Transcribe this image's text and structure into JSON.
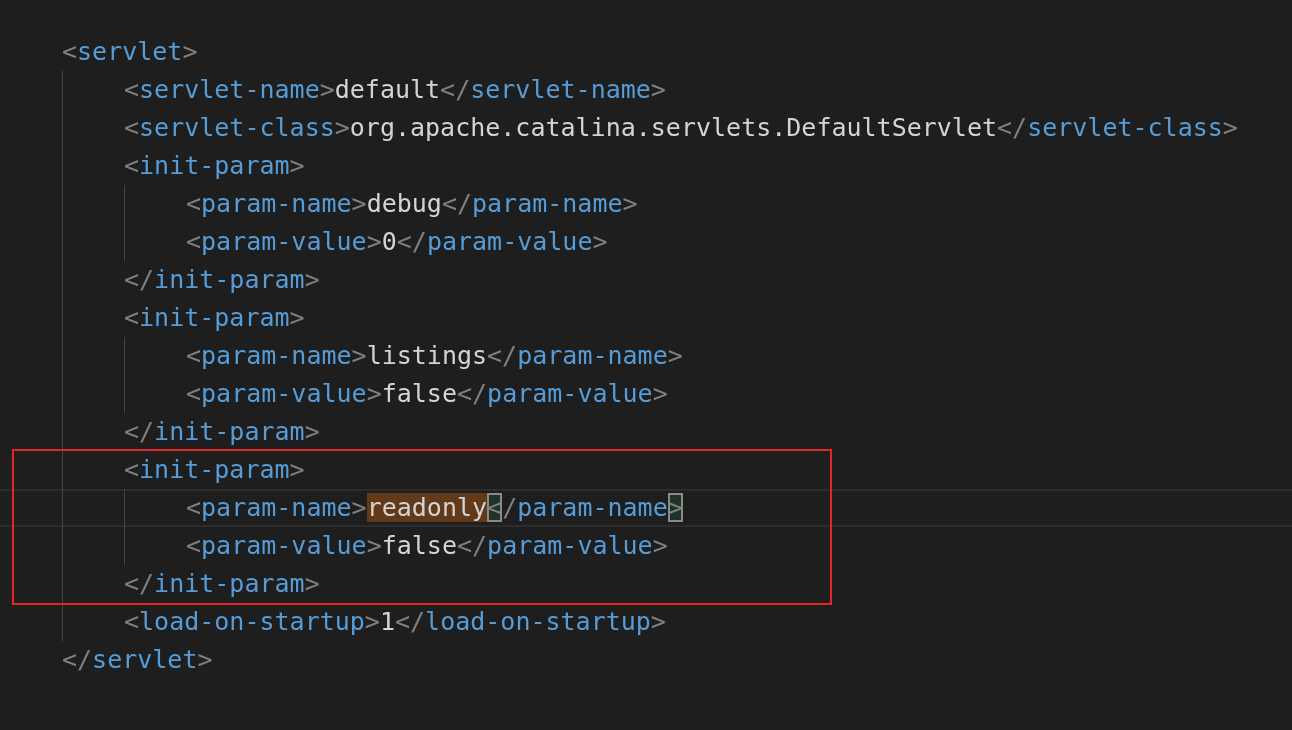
{
  "editor": {
    "document": [
      {
        "line": [
          {
            "kind": "punct",
            "text": "<"
          },
          {
            "kind": "tag",
            "text": "servlet"
          },
          {
            "kind": "punct",
            "text": ">"
          }
        ],
        "children": [
          {
            "line": [
              {
                "kind": "punct",
                "text": "<"
              },
              {
                "kind": "tag",
                "text": "servlet-name"
              },
              {
                "kind": "punct",
                "text": ">"
              },
              {
                "kind": "text",
                "text": "default"
              },
              {
                "kind": "punct",
                "text": "</"
              },
              {
                "kind": "tag",
                "text": "servlet-name"
              },
              {
                "kind": "punct",
                "text": ">"
              }
            ]
          },
          {
            "line": [
              {
                "kind": "punct",
                "text": "<"
              },
              {
                "kind": "tag",
                "text": "servlet-class"
              },
              {
                "kind": "punct",
                "text": ">"
              },
              {
                "kind": "text",
                "text": "org.apache.catalina.servlets.DefaultServlet"
              },
              {
                "kind": "punct",
                "text": "</"
              },
              {
                "kind": "tag",
                "text": "servlet-class"
              },
              {
                "kind": "punct",
                "text": ">"
              }
            ]
          },
          {
            "line": [
              {
                "kind": "punct",
                "text": "<"
              },
              {
                "kind": "tag",
                "text": "init-param"
              },
              {
                "kind": "punct",
                "text": ">"
              }
            ],
            "children": [
              {
                "line": [
                  {
                    "kind": "punct",
                    "text": "<"
                  },
                  {
                    "kind": "tag",
                    "text": "param-name"
                  },
                  {
                    "kind": "punct",
                    "text": ">"
                  },
                  {
                    "kind": "text",
                    "text": "debug"
                  },
                  {
                    "kind": "punct",
                    "text": "</"
                  },
                  {
                    "kind": "tag",
                    "text": "param-name"
                  },
                  {
                    "kind": "punct",
                    "text": ">"
                  }
                ]
              },
              {
                "line": [
                  {
                    "kind": "punct",
                    "text": "<"
                  },
                  {
                    "kind": "tag",
                    "text": "param-value"
                  },
                  {
                    "kind": "punct",
                    "text": ">"
                  },
                  {
                    "kind": "text",
                    "text": "0"
                  },
                  {
                    "kind": "punct",
                    "text": "</"
                  },
                  {
                    "kind": "tag",
                    "text": "param-value"
                  },
                  {
                    "kind": "punct",
                    "text": ">"
                  }
                ]
              }
            ],
            "close": [
              {
                "kind": "punct",
                "text": "</"
              },
              {
                "kind": "tag",
                "text": "init-param"
              },
              {
                "kind": "punct",
                "text": ">"
              }
            ]
          },
          {
            "line": [
              {
                "kind": "punct",
                "text": "<"
              },
              {
                "kind": "tag",
                "text": "init-param"
              },
              {
                "kind": "punct",
                "text": ">"
              }
            ],
            "children": [
              {
                "line": [
                  {
                    "kind": "punct",
                    "text": "<"
                  },
                  {
                    "kind": "tag",
                    "text": "param-name"
                  },
                  {
                    "kind": "punct",
                    "text": ">"
                  },
                  {
                    "kind": "text",
                    "text": "listings"
                  },
                  {
                    "kind": "punct",
                    "text": "</"
                  },
                  {
                    "kind": "tag",
                    "text": "param-name"
                  },
                  {
                    "kind": "punct",
                    "text": ">"
                  }
                ]
              },
              {
                "line": [
                  {
                    "kind": "punct",
                    "text": "<"
                  },
                  {
                    "kind": "tag",
                    "text": "param-value"
                  },
                  {
                    "kind": "punct",
                    "text": ">"
                  },
                  {
                    "kind": "text",
                    "text": "false"
                  },
                  {
                    "kind": "punct",
                    "text": "</"
                  },
                  {
                    "kind": "tag",
                    "text": "param-value"
                  },
                  {
                    "kind": "punct",
                    "text": ">"
                  }
                ]
              }
            ],
            "close": [
              {
                "kind": "punct",
                "text": "</"
              },
              {
                "kind": "tag",
                "text": "init-param"
              },
              {
                "kind": "punct",
                "text": ">"
              }
            ]
          },
          {
            "annotated": true,
            "line": [
              {
                "kind": "punct",
                "text": "<"
              },
              {
                "kind": "tag",
                "text": "init-param"
              },
              {
                "kind": "punct",
                "text": ">"
              }
            ],
            "children": [
              {
                "current": true,
                "line": [
                  {
                    "kind": "punct",
                    "text": "<"
                  },
                  {
                    "kind": "tag",
                    "text": "param-name"
                  },
                  {
                    "kind": "punct",
                    "text": ">"
                  },
                  {
                    "kind": "text",
                    "text": "readonly",
                    "word_highlight": true
                  },
                  {
                    "kind": "punct",
                    "text": "<",
                    "bracket_match": true
                  },
                  {
                    "kind": "punct",
                    "text": "/"
                  },
                  {
                    "kind": "tag",
                    "text": "param-name"
                  },
                  {
                    "kind": "punct",
                    "text": ">",
                    "bracket_match": true
                  }
                ]
              },
              {
                "line": [
                  {
                    "kind": "punct",
                    "text": "<"
                  },
                  {
                    "kind": "tag",
                    "text": "param-value"
                  },
                  {
                    "kind": "punct",
                    "text": ">"
                  },
                  {
                    "kind": "text",
                    "text": "false"
                  },
                  {
                    "kind": "punct",
                    "text": "</"
                  },
                  {
                    "kind": "tag",
                    "text": "param-value"
                  },
                  {
                    "kind": "punct",
                    "text": ">"
                  }
                ]
              }
            ],
            "close": [
              {
                "kind": "punct",
                "text": "</"
              },
              {
                "kind": "tag",
                "text": "init-param"
              },
              {
                "kind": "punct",
                "text": ">"
              }
            ]
          },
          {
            "line": [
              {
                "kind": "punct",
                "text": "<"
              },
              {
                "kind": "tag",
                "text": "load-on-startup"
              },
              {
                "kind": "punct",
                "text": ">"
              },
              {
                "kind": "text",
                "text": "1"
              },
              {
                "kind": "punct",
                "text": "</"
              },
              {
                "kind": "tag",
                "text": "load-on-startup"
              },
              {
                "kind": "punct",
                "text": ">"
              }
            ]
          }
        ],
        "close": [
          {
            "kind": "punct",
            "text": "</"
          },
          {
            "kind": "tag",
            "text": "servlet"
          },
          {
            "kind": "punct",
            "text": ">"
          }
        ]
      }
    ]
  }
}
